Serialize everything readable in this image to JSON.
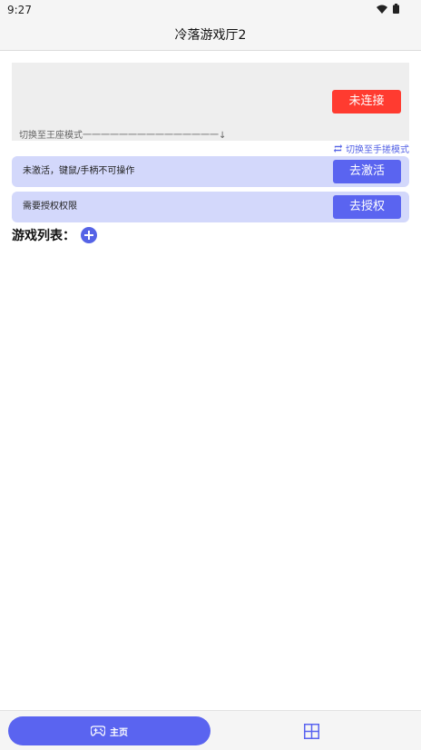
{
  "status_bar": {
    "time": "9:27"
  },
  "app_bar": {
    "title": "冷落游戏厅2"
  },
  "connection": {
    "button_label": "未连接",
    "mode_text": "切换至王座模式一一一一一一一一一一一一一一一↓",
    "switch_link": "切换至手搓模式"
  },
  "notices": {
    "activate_text": "未激活，键鼠/手柄不可操作",
    "activate_button": "去激活",
    "auth_text": "需要授权权限",
    "auth_button": "去授权"
  },
  "games": {
    "title": "游戏列表："
  },
  "bottom_nav": {
    "home_label": "主页"
  },
  "colors": {
    "accent": "#5a64f0",
    "danger": "#ff3b30",
    "notice_bg": "#d3d8fb"
  }
}
